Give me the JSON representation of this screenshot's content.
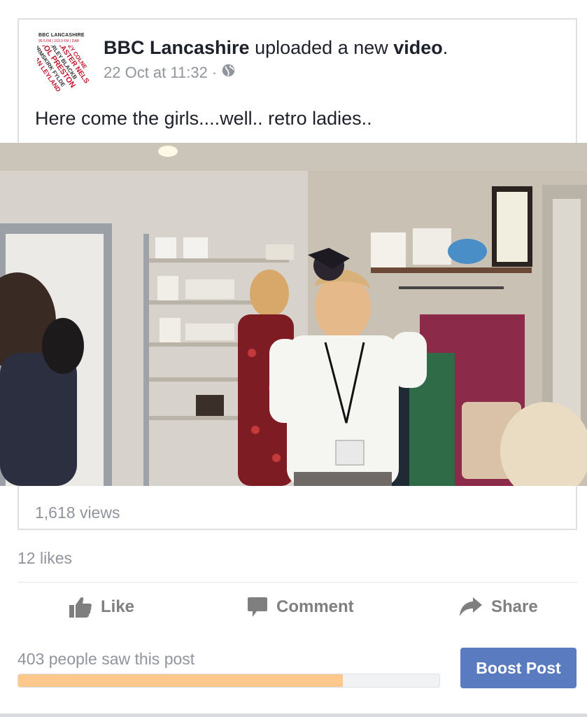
{
  "post": {
    "page_name": "BBC Lancashire",
    "action_text": " uploaded a new ",
    "object": "video",
    "period": ".",
    "timestamp": "22 Oct at 11:32",
    "separator": "·",
    "privacy_icon": "globe-icon",
    "text": "Here come the girls....well.. retro ladies.."
  },
  "avatar": {
    "bbc_text": "BBC LANCASHIRE",
    "freq_text": "95.5 FM | 103.9 FM | DAB",
    "colors": [
      "#c0172d",
      "#3a3a3a"
    ]
  },
  "video": {
    "views": "1,618 views"
  },
  "engagement": {
    "likes": "12 likes"
  },
  "actions": {
    "like": {
      "label": "Like",
      "icon": "thumbs-up-icon"
    },
    "comment": {
      "label": "Comment",
      "icon": "comment-icon"
    },
    "share": {
      "label": "Share",
      "icon": "share-arrow-icon"
    }
  },
  "insights": {
    "reach_text": "403 people saw this post",
    "reach_fraction": 0.77,
    "boost_label": "Boost Post"
  },
  "colors": {
    "text": "#1d2129",
    "secondary": "#90949c",
    "action": "#7f7f7f",
    "boost": "#5b7bc0",
    "reach_fill": "#fcc88b"
  }
}
